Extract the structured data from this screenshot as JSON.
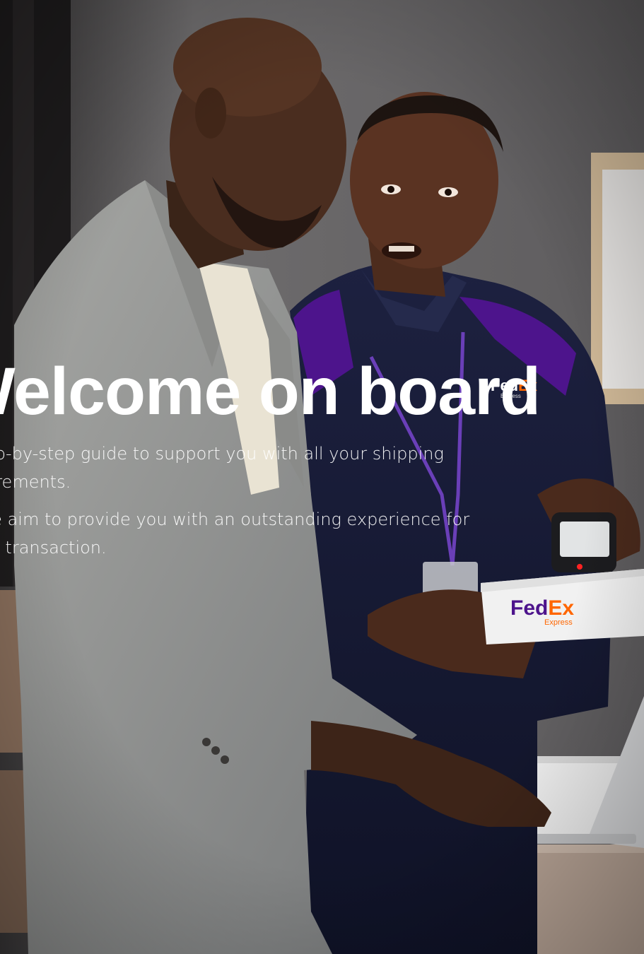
{
  "hero": {
    "headline": "Welcome on board",
    "paragraph_1": "A step-by-step guide to support you with all your shipping requirements.",
    "paragraph_2": "As we aim to provide you with an outstanding experience for every transaction."
  },
  "brand": {
    "logo_text_fed": "Fed",
    "logo_text_ex": "Ex",
    "logo_sub": "Express",
    "purple": "#4d148c",
    "orange": "#ff6600"
  },
  "colors": {
    "background_wall": "#6b6a6c",
    "headline_color": "#ffffff"
  },
  "icons": [
    "fedex-logo-icon"
  ]
}
